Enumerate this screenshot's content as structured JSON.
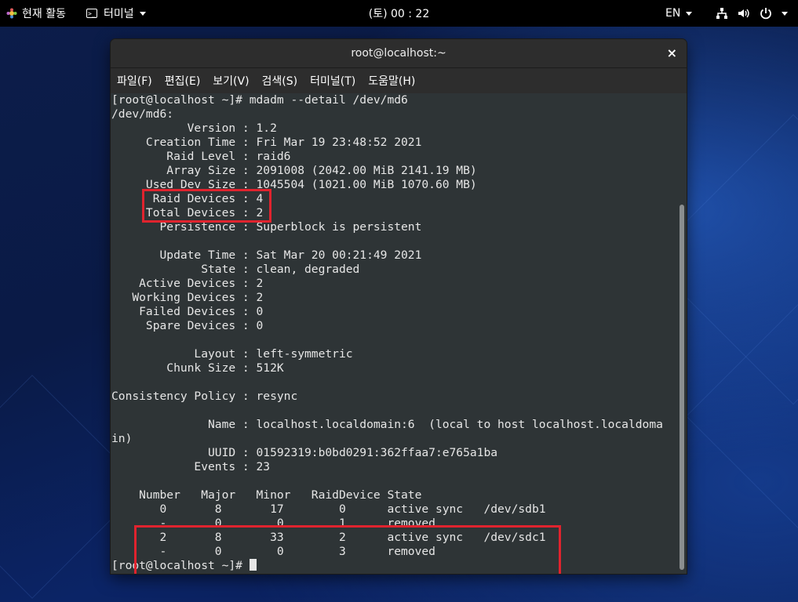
{
  "topbar": {
    "activities": "현재 활동",
    "app_menu": "터미널",
    "clock": "(토) 00 : 22",
    "language": "EN",
    "icons": [
      "network-icon",
      "volume-icon",
      "power-icon"
    ]
  },
  "window": {
    "title": "root@localhost:~",
    "close": "×",
    "menu": [
      "파일(F)",
      "편집(E)",
      "보기(V)",
      "검색(S)",
      "터미널(T)",
      "도움말(H)"
    ]
  },
  "terminal": {
    "lines": [
      "[root@localhost ~]# mdadm --detail /dev/md6",
      "/dev/md6:",
      "           Version : 1.2",
      "     Creation Time : Fri Mar 19 23:48:52 2021",
      "        Raid Level : raid6",
      "        Array Size : 2091008 (2042.00 MiB 2141.19 MB)",
      "     Used Dev Size : 1045504 (1021.00 MiB 1070.60 MB)",
      "      Raid Devices : 4",
      "     Total Devices : 2",
      "       Persistence : Superblock is persistent",
      "",
      "       Update Time : Sat Mar 20 00:21:49 2021",
      "             State : clean, degraded",
      "    Active Devices : 2",
      "   Working Devices : 2",
      "    Failed Devices : 0",
      "     Spare Devices : 0",
      "",
      "            Layout : left-symmetric",
      "        Chunk Size : 512K",
      "",
      "Consistency Policy : resync",
      "",
      "              Name : localhost.localdomain:6  (local to host localhost.localdoma",
      "in)",
      "              UUID : 01592319:b0bd0291:362ffaa7:e765a1ba",
      "            Events : 23",
      "",
      "    Number   Major   Minor   RaidDevice State",
      "       0       8       17        0      active sync   /dev/sdb1",
      "       -       0        0        1      removed",
      "       2       8       33        2      active sync   /dev/sdc1",
      "       -       0        0        3      removed"
    ],
    "prompt": "[root@localhost ~]# "
  },
  "colors": {
    "highlight": "#e0232e",
    "terminal_bg": "#2e3436",
    "terminal_fg": "#e6e6e6"
  }
}
